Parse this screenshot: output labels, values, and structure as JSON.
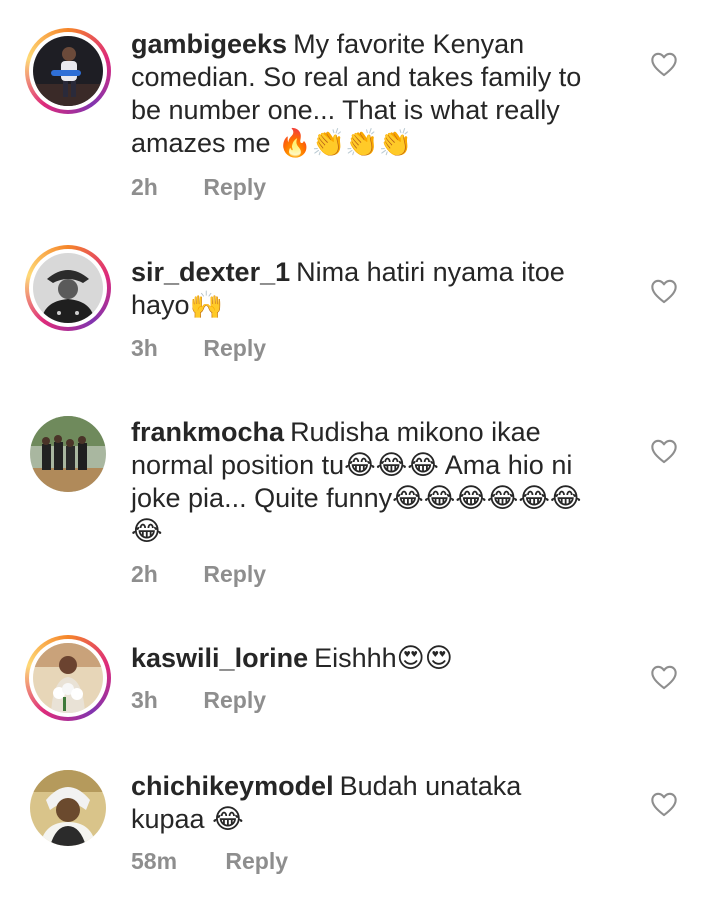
{
  "comments": [
    {
      "username": "gambigeeks",
      "text": "My favorite Kenyan comedian. So real and takes family to be number one... That is what really amazes me 🔥👏👏👏",
      "time": "2h",
      "reply_label": "Reply",
      "avatar_ring": true
    },
    {
      "username": "sir_dexter_1",
      "text": "Nima hatiri nyama itoe hayo🙌",
      "time": "3h",
      "reply_label": "Reply",
      "avatar_ring": true
    },
    {
      "username": "frankmocha",
      "text": "Rudisha mikono ikae normal position tu😂😂😂 Ama hio ni joke pia... Quite funny😂😂😂😂😂😂😂",
      "time": "2h",
      "reply_label": "Reply",
      "avatar_ring": false
    },
    {
      "username": "kaswili_lorine",
      "text": "Eishhh😍😍",
      "time": "3h",
      "reply_label": "Reply",
      "avatar_ring": true
    },
    {
      "username": "chichikeymodel",
      "text": "Budah unataka kupaa 😂",
      "time": "58m",
      "reply_label": "Reply",
      "avatar_ring": false
    }
  ],
  "icons": {
    "like": "heart-outline-icon"
  },
  "colors": {
    "text": "#262626",
    "meta": "#8e8e8e",
    "heart": "#8e8e8e",
    "ring_start": "#f58529",
    "ring_mid": "#dd2a7b",
    "ring_end": "#8134af"
  }
}
